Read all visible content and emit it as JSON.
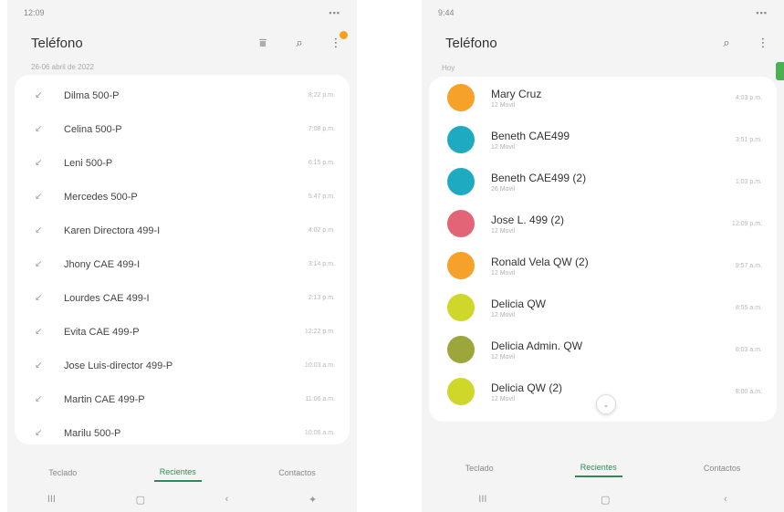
{
  "left": {
    "status": {
      "time": "12:09",
      "icons": "▪▪▪",
      "right_icons": "▪▪▪"
    },
    "title": "Teléfono",
    "date_header": "26-06 abril de 2022",
    "calls": [
      {
        "name": "Dilma 500-P",
        "time": "8:22 p.m."
      },
      {
        "name": "Celina 500-P",
        "time": "7:08 p.m."
      },
      {
        "name": "Leni 500-P",
        "time": "6:15 p.m."
      },
      {
        "name": "Mercedes 500-P",
        "time": "5:47 p.m."
      },
      {
        "name": "Karen Directora 499-I",
        "time": "4:02 p.m."
      },
      {
        "name": "Jhony CAE 499-I",
        "time": "3:14 p.m."
      },
      {
        "name": "Lourdes CAE 499-I",
        "time": "2:13 p.m."
      },
      {
        "name": "Evita CAE 499-P",
        "time": "12:22 p.m."
      },
      {
        "name": "Jose Luis-director 499-P",
        "time": "10:03 a.m."
      },
      {
        "name": "Martin CAE 499-P",
        "time": "11:06 a.m."
      },
      {
        "name": "Marilu 500-P",
        "time": "10:06 a.m."
      }
    ],
    "tabs": [
      "Teclado",
      "Recientes",
      "Contactos"
    ],
    "nav": [
      "III",
      "▢",
      "‹",
      "✦"
    ]
  },
  "right": {
    "status": {
      "time": "9:44",
      "icons": "▪▪▪",
      "right_icons": "▪▪▪"
    },
    "title": "Teléfono",
    "section": "Hoy",
    "contacts": [
      {
        "name": "Mary Cruz",
        "sub": "12 Movil",
        "time": "4:03 p.m.",
        "color": "#f5a12a"
      },
      {
        "name": "Beneth CAE499",
        "sub": "12 Movil",
        "time": "3:51 p.m.",
        "color": "#1eaac0"
      },
      {
        "name": "Beneth CAE499 (2)",
        "sub": "26 Movil",
        "time": "1:03 p.m.",
        "color": "#1eaac0"
      },
      {
        "name": "Jose L. 499 (2)",
        "sub": "12 Movil",
        "time": "12:09 p.m.",
        "color": "#e36477"
      },
      {
        "name": "Ronald Vela QW (2)",
        "sub": "12 Movil",
        "time": "9:57 a.m.",
        "color": "#f5a12a"
      },
      {
        "name": "Delicia QW",
        "sub": "12 Movil",
        "time": "8:55 a.m.",
        "color": "#cfd72b"
      },
      {
        "name": "Delicia Admin. QW",
        "sub": "12 Movil",
        "time": "8:03 a.m.",
        "color": "#9ca63b"
      },
      {
        "name": "Delicia QW (2)",
        "sub": "12 Movil",
        "time": "8:00 a.m.",
        "color": "#cfd72b"
      }
    ],
    "scroll_glyph": "⌄",
    "tabs": [
      "Teclado",
      "Recientes",
      "Contactos"
    ],
    "nav": [
      "III",
      "▢",
      "‹"
    ]
  },
  "icons": {
    "filter": "⩸",
    "search": "⌕",
    "more": "⋮",
    "call": "↙"
  },
  "accent": "#2e8b57"
}
